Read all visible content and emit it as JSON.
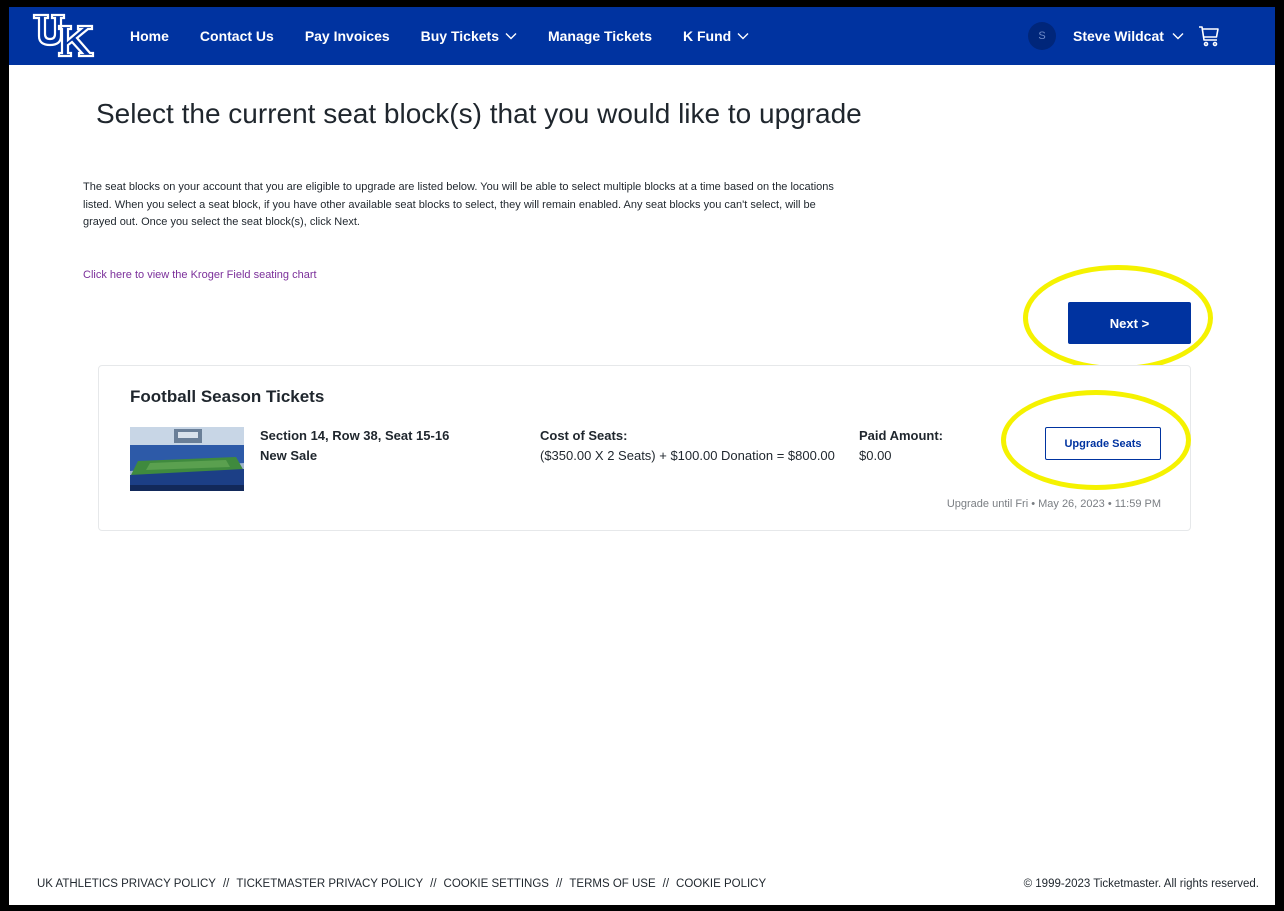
{
  "nav": {
    "logo_icon": "uk-logo-icon",
    "links": [
      {
        "label": "Home"
      },
      {
        "label": "Contact Us"
      },
      {
        "label": "Pay Invoices"
      },
      {
        "label": "Buy Tickets",
        "dropdown": true
      },
      {
        "label": "Manage Tickets"
      },
      {
        "label": "K Fund",
        "dropdown": true
      }
    ],
    "user": {
      "initial": "S",
      "name": "Steve Wildcat"
    },
    "cart_icon": "cart-icon"
  },
  "page": {
    "title": "Select the current seat block(s) that you would like to upgrade",
    "intro": "The seat blocks on your account that you are eligible to upgrade are listed below. You will be able to select multiple blocks at a time based on the locations listed. When you select a seat block, if you have other available seat blocks to select, they will remain enabled. Any seat blocks you can't select, will be grayed out. Once you select the seat block(s), click Next.",
    "chart_link": "Click here to view the Kroger Field seating chart",
    "next_label": "Next >"
  },
  "card": {
    "title": "Football Season Tickets",
    "seat": "Section 14, Row 38, Seat 15-16",
    "sale_type": "New Sale",
    "cost_label": "Cost of Seats:",
    "cost_detail": "($350.00 X 2 Seats) + $100.00 Donation = $800.00",
    "paid_label": "Paid Amount:",
    "paid_value": "$0.00",
    "upgrade_label": "Upgrade Seats",
    "deadline": "Upgrade until Fri • May 26, 2023 • 11:59 PM"
  },
  "footer": {
    "links": [
      "UK ATHLETICS PRIVACY POLICY",
      "TICKETMASTER PRIVACY POLICY",
      "COOKIE SETTINGS",
      "TERMS OF USE",
      "COOKIE POLICY"
    ],
    "separator": "//",
    "copyright": "© 1999-2023 Ticketmaster. All rights reserved."
  },
  "colors": {
    "nav_bg": "#0033a0",
    "highlight": "#f5f200",
    "link_purple": "#7b2f9a"
  }
}
